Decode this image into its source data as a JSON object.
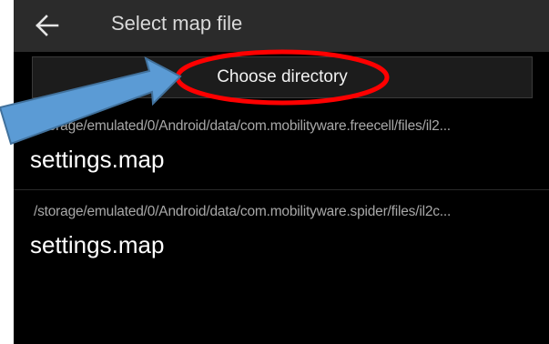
{
  "appbar": {
    "title": "Select map file",
    "back_icon": "arrow-left-icon"
  },
  "actions": {
    "choose_directory_label": "Choose directory"
  },
  "files": [
    {
      "path": "/storage/emulated/0/Android/data/com.mobilityware.freecell/files/il2...",
      "name": "settings.map"
    },
    {
      "path": "/storage/emulated/0/Android/data/com.mobilityware.spider/files/il2c...",
      "name": "settings.map"
    }
  ],
  "annotation": {
    "highlight_color": "#ff0000",
    "arrow_color": "#5b9bd5",
    "arrow_outline_color": "#41719c"
  }
}
